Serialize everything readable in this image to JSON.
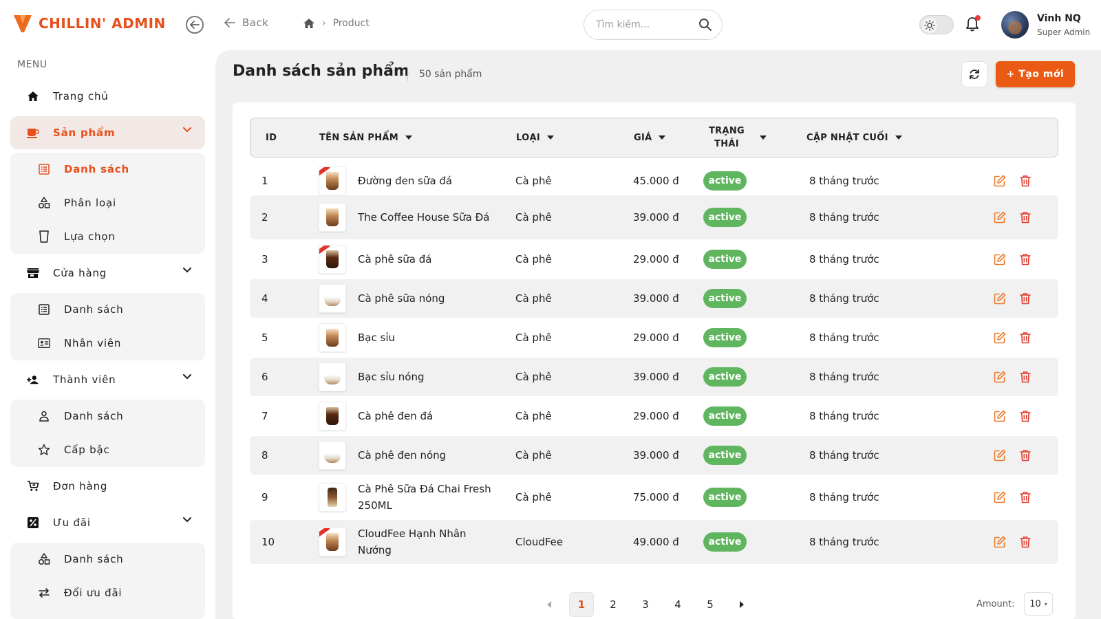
{
  "app": {
    "title": "CHILLIN' ADMIN"
  },
  "header": {
    "back_label": "Back",
    "breadcrumb": [
      "Product"
    ],
    "search_placeholder": "Tìm kiếm...",
    "user": {
      "name": "Vinh NQ",
      "role": "Super Admin"
    },
    "notification_dot_color": "#ef3b3b"
  },
  "sidebar": {
    "menu_label": "MENU",
    "items": [
      {
        "label": "Trang chủ",
        "icon": "home-icon"
      },
      {
        "label": "Sản phẩm",
        "icon": "coffee-cup-icon",
        "active": true,
        "children": [
          {
            "label": "Danh sách",
            "icon": "list-icon",
            "active": true
          },
          {
            "label": "Phân loại",
            "icon": "shapes-icon"
          },
          {
            "label": "Lựa chọn",
            "icon": "cup-icon"
          }
        ]
      },
      {
        "label": "Cửa hàng",
        "icon": "store-icon",
        "children": [
          {
            "label": "Danh sách",
            "icon": "list-icon"
          },
          {
            "label": "Nhân viên",
            "icon": "id-card-icon"
          }
        ]
      },
      {
        "label": "Thành viên",
        "icon": "user-add-icon",
        "children": [
          {
            "label": "Danh sách",
            "icon": "user-icon"
          },
          {
            "label": "Cấp bậc",
            "icon": "star-icon"
          }
        ]
      },
      {
        "label": "Đơn hàng",
        "icon": "cart-icon"
      },
      {
        "label": "Ưu đãi",
        "icon": "percent-icon",
        "children": [
          {
            "label": "Danh sách",
            "icon": "shapes-icon"
          },
          {
            "label": "Đổi ưu đãi",
            "icon": "swap-icon"
          }
        ]
      }
    ]
  },
  "main": {
    "title": "Danh sách sản phẩm",
    "count_label": "50 sản phẩm",
    "create_label": "+ Tạo mới",
    "table": {
      "headers": {
        "id": "ID",
        "name": "TÊN SẢN PHẨM",
        "type": "LOẠI",
        "price": "GIÁ",
        "status_line1": "TRẠNG",
        "status_line2": "THÁI",
        "updated": "CẬP NHẬT CUỐI"
      },
      "rows": [
        {
          "id": "1",
          "name": "Đường đen sữa đá",
          "type": "Cà phê",
          "price": "45.000 đ",
          "status": "active",
          "updated": "8 tháng trước"
        },
        {
          "id": "2",
          "name": "The Coffee House Sữa Đá",
          "type": "Cà phê",
          "price": "39.000 đ",
          "status": "active",
          "updated": "8 tháng trước"
        },
        {
          "id": "3",
          "name": "Cà phê sữa đá",
          "type": "Cà phê",
          "price": "29.000 đ",
          "status": "active",
          "updated": "8 tháng trước"
        },
        {
          "id": "4",
          "name": "Cà phê sữa nóng",
          "type": "Cà phê",
          "price": "39.000 đ",
          "status": "active",
          "updated": "8 tháng trước"
        },
        {
          "id": "5",
          "name": "Bạc sỉu",
          "type": "Cà phê",
          "price": "29.000 đ",
          "status": "active",
          "updated": "8 tháng trước"
        },
        {
          "id": "6",
          "name": "Bạc sỉu nóng",
          "type": "Cà phê",
          "price": "39.000 đ",
          "status": "active",
          "updated": "8 tháng trước"
        },
        {
          "id": "7",
          "name": "Cà phê đen đá",
          "type": "Cà phê",
          "price": "29.000 đ",
          "status": "active",
          "updated": "8 tháng trước"
        },
        {
          "id": "8",
          "name": "Cà phê đen nóng",
          "type": "Cà phê",
          "price": "39.000 đ",
          "status": "active",
          "updated": "8 tháng trước"
        },
        {
          "id": "9",
          "name": "Cà Phê Sữa Đá Chai Fresh 250ML",
          "type": "Cà phê",
          "price": "75.000 đ",
          "status": "active",
          "updated": "8 tháng trước"
        },
        {
          "id": "10",
          "name": "CloudFee Hạnh Nhân Nướng",
          "type": "CloudFee",
          "price": "49.000 đ",
          "status": "active",
          "updated": "8 tháng trước"
        }
      ]
    },
    "pagination": {
      "pages": [
        "1",
        "2",
        "3",
        "4",
        "5"
      ],
      "current": "1",
      "amount_label": "Amount:",
      "amount_value": "10"
    }
  },
  "colors": {
    "accent": "#e8501b",
    "active_badge": "#5fb65f",
    "edit_icon": "#ef7a2a",
    "delete_icon": "#e23b2e"
  }
}
